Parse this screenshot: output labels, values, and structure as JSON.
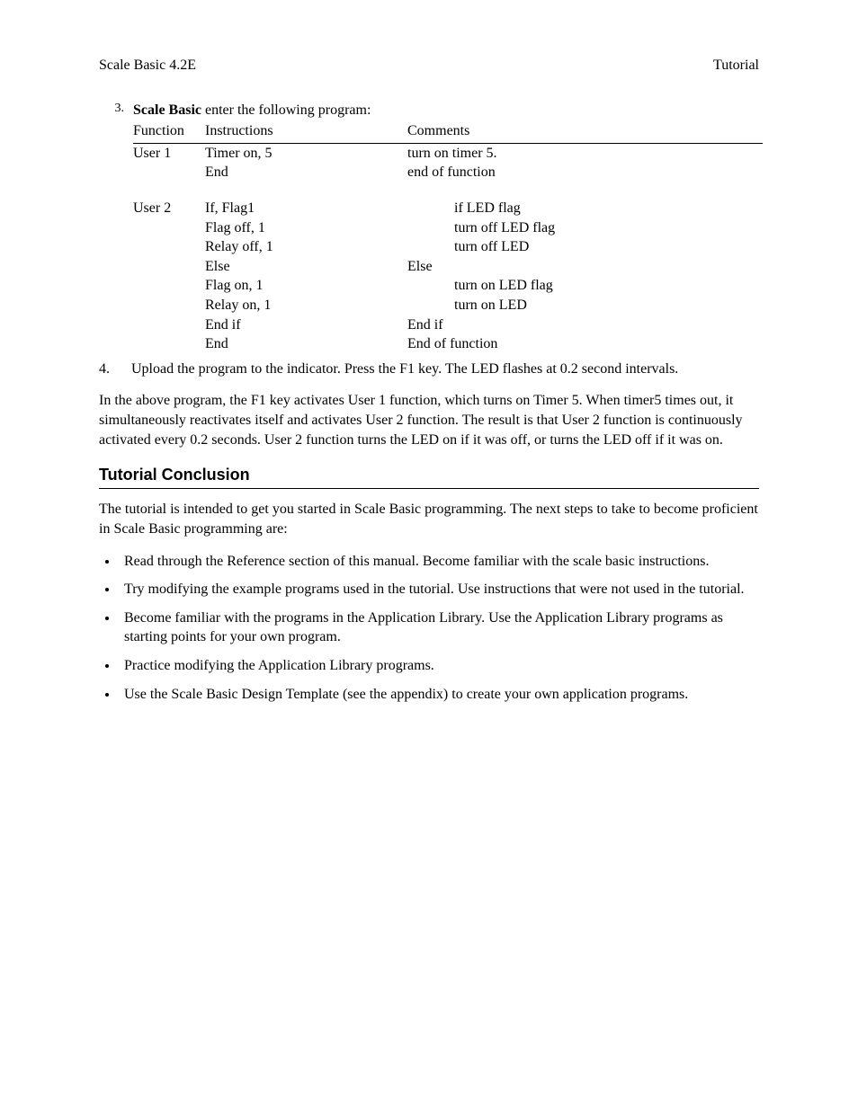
{
  "header": {
    "left": "Scale Basic 4.2E",
    "right": "Tutorial"
  },
  "item3": {
    "num": "3.",
    "lead_bold": "Scale Basic",
    "lead_rest": " enter the following program:",
    "th_func": "Function",
    "th_instr": "Instructions",
    "th_comm": "Comments",
    "rows": [
      {
        "func": "User 1",
        "instr": "Timer on, 5",
        "comm": "turn on timer 5."
      },
      {
        "func": "",
        "instr": "End",
        "comm": "end of function"
      }
    ],
    "rows2": [
      {
        "func": "User 2",
        "instr": "If, Flag1",
        "comm_indent": true,
        "comm": "if LED flag"
      },
      {
        "func": "",
        "instr": "Flag off, 1",
        "comm_indent": true,
        "comm": "turn off LED flag"
      },
      {
        "func": "",
        "instr": "Relay off, 1",
        "comm_indent": true,
        "comm": "turn off LED"
      },
      {
        "func": "",
        "instr": "Else",
        "comm_indent": false,
        "comm": "Else"
      },
      {
        "func": "",
        "instr": "Flag on, 1",
        "comm_indent": true,
        "comm": "turn on LED flag"
      },
      {
        "func": "",
        "instr": "Relay on, 1",
        "comm_indent": true,
        "comm": "turn on LED"
      },
      {
        "func": "",
        "instr": "End if",
        "comm_indent": false,
        "comm": "End if"
      },
      {
        "func": "",
        "instr": "End",
        "comm_indent": false,
        "comm": "End of function"
      }
    ]
  },
  "item4": {
    "num": "4.",
    "text": "Upload the program to the indicator.  Press the F1 key.  The LED flashes at 0.2 second intervals."
  },
  "explain_para": "In the above program, the F1 key activates User 1 function, which turns on Timer 5.  When timer5 times out, it simultaneously reactivates itself and activates User 2 function.   The result is that User 2 function is continuously  activated every 0.2 seconds.  User 2 function turns the LED on if it was off, or turns the LED off if it was on.",
  "section_title": "Tutorial Conclusion",
  "conclusion_para": "The tutorial is intended to get you started in Scale Basic programming. The next steps to take to become proficient in Scale Basic programming are:",
  "bullets": [
    "Read through the Reference section of this manual.  Become familiar with the scale basic instructions.",
    "Try modifying the example programs used in the tutorial.  Use instructions that were not used in the tutorial.",
    "Become familiar with the programs in the Application Library.  Use the Application Library programs as starting points for your own program.",
    "Practice modifying the Application Library programs.",
    "Use the Scale Basic Design Template (see the appendix) to create your own application programs."
  ]
}
